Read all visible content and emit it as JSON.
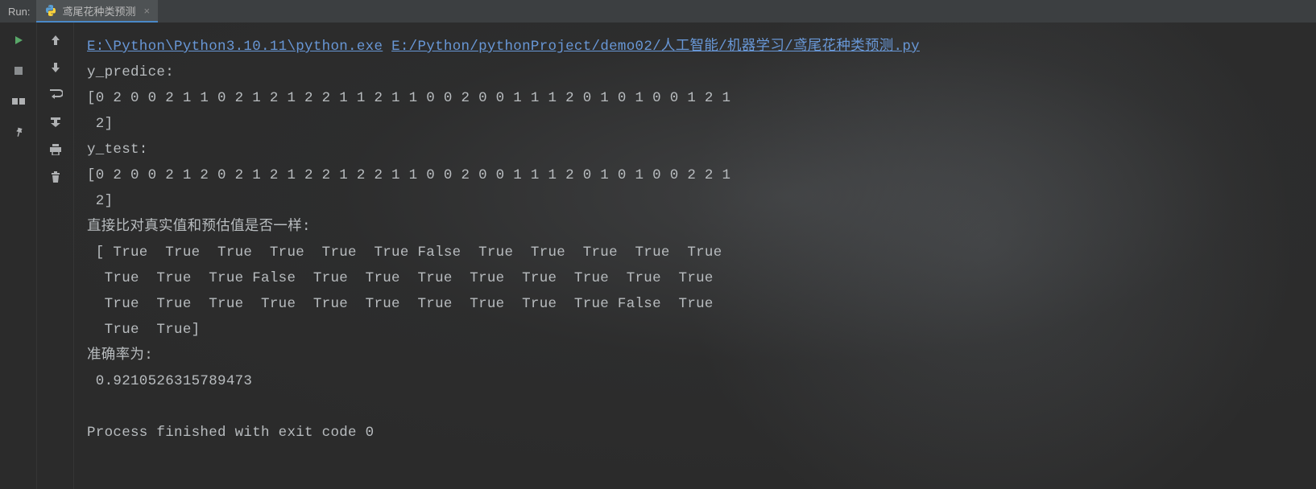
{
  "header": {
    "run_label": "Run:",
    "tab_title": "鸢尾花种类预测"
  },
  "links": {
    "python_exe": "E:\\Python\\Python3.10.11\\python.exe",
    "script_path": "E:/Python/pythonProject/demo02/人工智能/机器学习/鸢尾花种类预测.py"
  },
  "output": {
    "y_predice_label": "y_predice:",
    "y_predice_line1": "[0 2 0 0 2 1 1 0 2 1 2 1 2 2 1 1 2 1 1 0 0 2 0 0 1 1 1 2 0 1 0 1 0 0 1 2 1",
    "y_predice_line2": " 2]",
    "y_test_label": "y_test:",
    "y_test_line1": "[0 2 0 0 2 1 2 0 2 1 2 1 2 2 1 2 2 1 1 0 0 2 0 0 1 1 1 2 0 1 0 1 0 0 2 2 1",
    "y_test_line2": " 2]",
    "compare_label": "直接比对真实值和预估值是否一样:",
    "bool_line1": " [ True  True  True  True  True  True False  True  True  True  True  True",
    "bool_line2": "  True  True  True False  True  True  True  True  True  True  True  True",
    "bool_line3": "  True  True  True  True  True  True  True  True  True  True False  True",
    "bool_line4": "  True  True]",
    "accuracy_label": "准确率为:",
    "accuracy_value": " 0.9210526315789473",
    "blank": "",
    "exit_line": "Process finished with exit code 0"
  }
}
